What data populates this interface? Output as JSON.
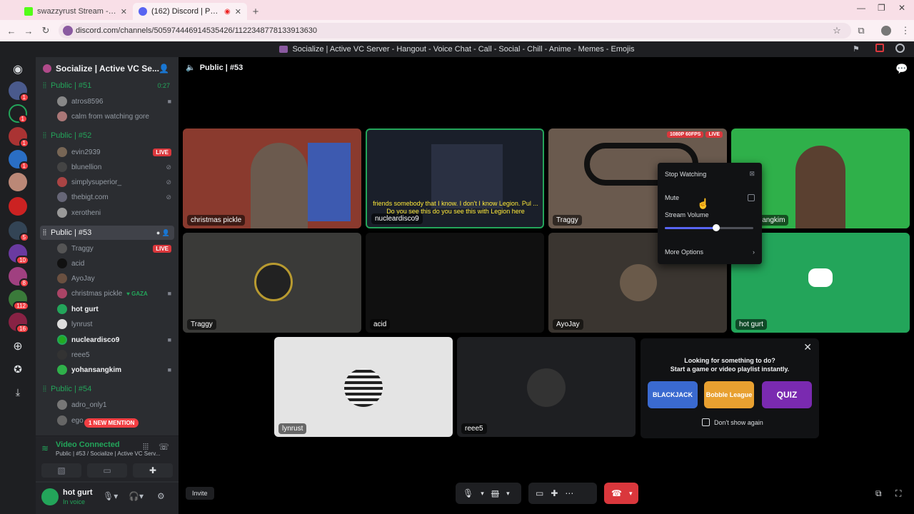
{
  "browser": {
    "tabs": [
      {
        "title": "swazzyrust Stream - Watch Live",
        "active": false
      },
      {
        "title": "(162) Discord | Public | #53",
        "active": true
      }
    ],
    "url": "discord.com/channels/505974446914535426/1122348778133913630"
  },
  "app": {
    "window_title": "Socialize | Active VC Server - Hangout - Voice Chat - Call - Social - Chill - Anime - Memes - Emojis",
    "server_name": "Socialize | Active VC Se...",
    "current_channel": "Public | #53"
  },
  "guild_badges": [
    "1",
    "1",
    "1",
    "1",
    "5",
    "1",
    "10",
    "8",
    "112",
    "16"
  ],
  "channels": [
    {
      "name": "Public | #51",
      "timer": "0:27",
      "users": [
        {
          "name": "atros8596",
          "bold": false
        },
        {
          "name": "calm from watching gore",
          "bold": false
        }
      ]
    },
    {
      "name": "Public | #52",
      "users": [
        {
          "name": "evin2939",
          "live": "LIVE"
        },
        {
          "name": "blunellion"
        },
        {
          "name": "simplysuperior_"
        },
        {
          "name": "thebigt.com"
        },
        {
          "name": "xerotheni"
        }
      ]
    },
    {
      "name": "Public | #53",
      "selected": true,
      "users": [
        {
          "name": "Traggy",
          "live": "LIVE"
        },
        {
          "name": "acid"
        },
        {
          "name": "AyoJay"
        },
        {
          "name": "christmas pickle",
          "tag": "GAZA"
        },
        {
          "name": "hot gurt",
          "bold": true
        },
        {
          "name": "lynrust"
        },
        {
          "name": "nucleardisco9",
          "bold": true
        },
        {
          "name": "reee5"
        },
        {
          "name": "yohansangkim",
          "bold": true
        }
      ]
    },
    {
      "name": "Public | #54",
      "users": [
        {
          "name": "adro_only1"
        },
        {
          "name": "ego"
        }
      ]
    }
  ],
  "mention_banner": "1 NEW MENTION",
  "voice_panel": {
    "status": "Video Connected",
    "detail": "Public | #53 / Socialize | Active VC Serv..."
  },
  "user_panel": {
    "name": "hot gurt",
    "status": "In voice"
  },
  "tiles": [
    {
      "label": "christmas pickle",
      "bg": "#8a3a2e"
    },
    {
      "label": "nucleardisco9",
      "bg": "#1a1f2a",
      "subtitle": "friends somebody that I know. I don't I know Legion. Pul ... Do you see this do you see this with Legion here"
    },
    {
      "label": "Traggy",
      "bg": "#6a5a4e",
      "badge": "1080P 60FPS",
      "live": "LIVE"
    },
    {
      "label": "yohansangkim",
      "bg": "#2fb04a"
    },
    {
      "label": "Traggy",
      "bg": "#3a3a38"
    },
    {
      "label": "acid",
      "bg": "#101010"
    },
    {
      "label": "AyoJay",
      "bg": "#3a3530"
    },
    {
      "label": "hot gurt",
      "bg": "#23a55a"
    },
    {
      "label": "lynrust",
      "bg": "#e4e4e4"
    },
    {
      "label": "reee5",
      "bg": "#1e1f22"
    }
  ],
  "popup": {
    "stop": "Stop Watching",
    "mute": "Mute",
    "volume_label": "Stream Volume",
    "volume_pct": 0.58,
    "more": "More Options"
  },
  "activity": {
    "line1": "Looking for something to do?",
    "line2": "Start a game or video playlist instantly.",
    "games": [
      "BLACKJACK",
      "Bobble League",
      "QUIZ"
    ],
    "dont_show": "Don't show again"
  },
  "invite_label": "Invite"
}
